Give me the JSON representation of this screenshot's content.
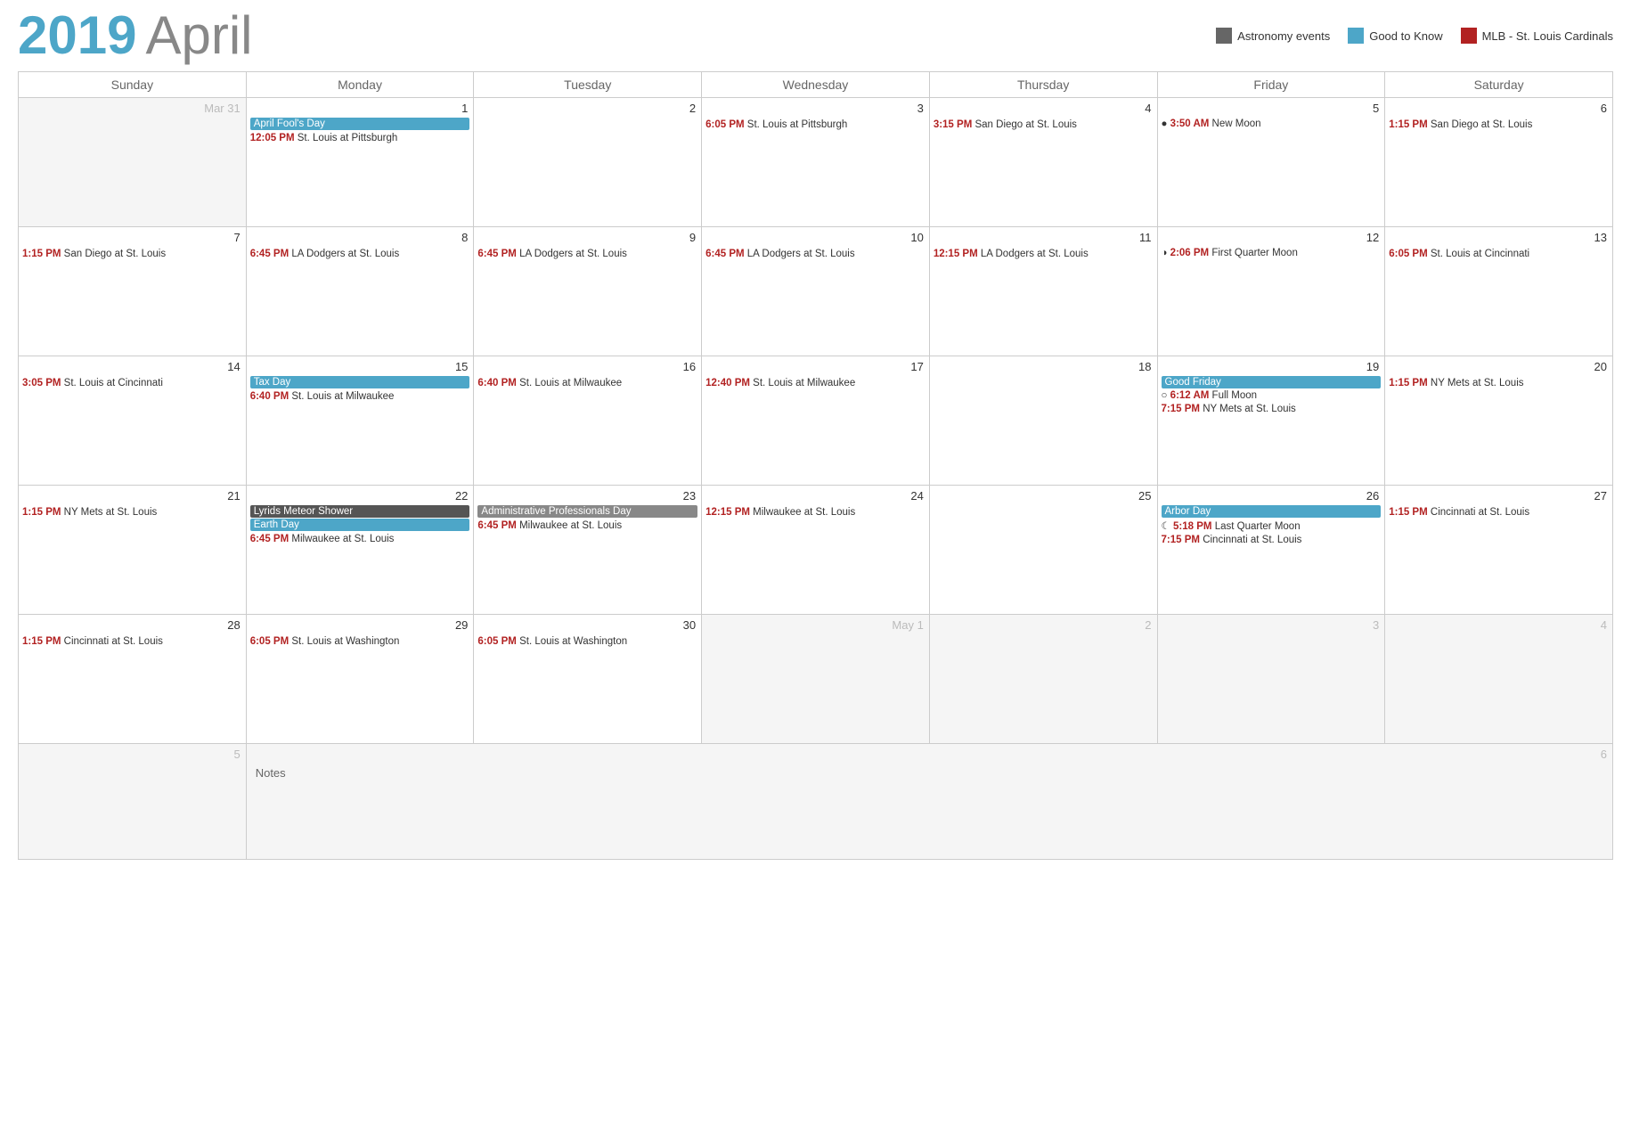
{
  "header": {
    "year": "2019",
    "month": "April"
  },
  "legend": [
    {
      "id": "astronomy",
      "label": "Astronomy events",
      "color_class": "astronomy"
    },
    {
      "id": "goodtoknow",
      "label": "Good to Know",
      "color_class": "goodtoknow"
    },
    {
      "id": "mlb",
      "label": "MLB - St. Louis Cardinals",
      "color_class": "mlb"
    }
  ],
  "days_of_week": [
    "Sunday",
    "Monday",
    "Tuesday",
    "Wednesday",
    "Thursday",
    "Friday",
    "Saturday"
  ],
  "weeks": [
    {
      "days": [
        {
          "num": "Mar 31",
          "gray": true,
          "events": []
        },
        {
          "num": "1",
          "events": [
            {
              "type": "bar-teal",
              "text": "April Fool's Day"
            },
            {
              "type": "mlb",
              "time": "12:05 PM",
              "desc": "St. Louis at Pittsburgh"
            }
          ]
        },
        {
          "num": "2",
          "events": []
        },
        {
          "num": "3",
          "events": [
            {
              "type": "mlb",
              "time": "6:05 PM",
              "desc": "St. Louis at Pittsburgh"
            }
          ]
        },
        {
          "num": "4",
          "events": [
            {
              "type": "mlb",
              "time": "3:15 PM",
              "desc": "San Diego at St. Louis"
            }
          ]
        },
        {
          "num": "5",
          "events": [
            {
              "type": "moon",
              "symbol": "●",
              "time": "3:50 AM",
              "desc": "New Moon"
            }
          ]
        },
        {
          "num": "6",
          "events": [
            {
              "type": "mlb",
              "time": "1:15 PM",
              "desc": "San Diego at St. Louis"
            }
          ]
        }
      ]
    },
    {
      "days": [
        {
          "num": "7",
          "events": [
            {
              "type": "mlb",
              "time": "1:15 PM",
              "desc": "San Diego at St. Louis"
            }
          ]
        },
        {
          "num": "8",
          "events": [
            {
              "type": "mlb",
              "time": "6:45 PM",
              "desc": "LA Dodgers at St. Louis"
            }
          ]
        },
        {
          "num": "9",
          "events": [
            {
              "type": "mlb",
              "time": "6:45 PM",
              "desc": "LA Dodgers at St. Louis"
            }
          ]
        },
        {
          "num": "10",
          "events": [
            {
              "type": "mlb",
              "time": "6:45 PM",
              "desc": "LA Dodgers at St. Louis"
            }
          ]
        },
        {
          "num": "11",
          "events": [
            {
              "type": "mlb",
              "time": "12:15 PM",
              "desc": "LA Dodgers at St. Louis"
            }
          ]
        },
        {
          "num": "12",
          "events": [
            {
              "type": "moon",
              "symbol": "◑",
              "time": "2:06 PM",
              "desc": "First Quarter Moon"
            }
          ]
        },
        {
          "num": "13",
          "events": [
            {
              "type": "mlb",
              "time": "6:05 PM",
              "desc": "St. Louis at Cincinnati"
            }
          ]
        }
      ]
    },
    {
      "days": [
        {
          "num": "14",
          "events": [
            {
              "type": "mlb",
              "time": "3:05 PM",
              "desc": "St. Louis at Cincinnati"
            }
          ]
        },
        {
          "num": "15",
          "events": [
            {
              "type": "bar-teal",
              "text": "Tax Day"
            },
            {
              "type": "mlb",
              "time": "6:40 PM",
              "desc": "St. Louis at Milwaukee"
            }
          ]
        },
        {
          "num": "16",
          "events": [
            {
              "type": "mlb",
              "time": "6:40 PM",
              "desc": "St. Louis at Milwaukee"
            }
          ]
        },
        {
          "num": "17",
          "events": [
            {
              "type": "mlb",
              "time": "12:40 PM",
              "desc": "St. Louis at Milwaukee"
            }
          ]
        },
        {
          "num": "18",
          "events": []
        },
        {
          "num": "19",
          "events": [
            {
              "type": "bar-teal",
              "text": "Good Friday"
            },
            {
              "type": "moon",
              "symbol": "○",
              "time": "6:12 AM",
              "desc": "Full Moon"
            },
            {
              "type": "mlb",
              "time": "7:15 PM",
              "desc": "NY Mets at St. Louis"
            }
          ]
        },
        {
          "num": "20",
          "events": [
            {
              "type": "mlb",
              "time": "1:15 PM",
              "desc": "NY Mets at St. Louis"
            }
          ]
        }
      ]
    },
    {
      "days": [
        {
          "num": "21",
          "events": [
            {
              "type": "mlb",
              "time": "1:15 PM",
              "desc": "NY Mets at St. Louis"
            }
          ]
        },
        {
          "num": "22",
          "events": [
            {
              "type": "bar-dark",
              "text": "Lyrids Meteor Shower"
            },
            {
              "type": "bar-teal",
              "text": "Earth Day"
            },
            {
              "type": "mlb",
              "time": "6:45 PM",
              "desc": "Milwaukee at St. Louis"
            }
          ]
        },
        {
          "num": "23",
          "events": [
            {
              "type": "bar-gray",
              "text": "Administrative Professionals Day"
            },
            {
              "type": "mlb",
              "time": "6:45 PM",
              "desc": "Milwaukee at St. Louis"
            }
          ]
        },
        {
          "num": "24",
          "events": [
            {
              "type": "mlb",
              "time": "12:15 PM",
              "desc": "Milwaukee at St. Louis"
            }
          ]
        },
        {
          "num": "25",
          "events": []
        },
        {
          "num": "26",
          "events": [
            {
              "type": "bar-teal",
              "text": "Arbor Day"
            },
            {
              "type": "moon",
              "symbol": "☾",
              "time": "5:18 PM",
              "desc": "Last Quarter Moon"
            },
            {
              "type": "mlb",
              "time": "7:15 PM",
              "desc": "Cincinnati at St. Louis"
            }
          ]
        },
        {
          "num": "27",
          "events": [
            {
              "type": "mlb",
              "time": "1:15 PM",
              "desc": "Cincinnati at St. Louis"
            }
          ]
        }
      ]
    },
    {
      "days": [
        {
          "num": "28",
          "events": [
            {
              "type": "mlb",
              "time": "1:15 PM",
              "desc": "Cincinnati at St. Louis"
            }
          ]
        },
        {
          "num": "29",
          "events": [
            {
              "type": "mlb",
              "time": "6:05 PM",
              "desc": "St. Louis at Washington"
            }
          ]
        },
        {
          "num": "30",
          "events": [
            {
              "type": "mlb",
              "time": "6:05 PM",
              "desc": "St. Louis at Washington"
            }
          ]
        },
        {
          "num": "May 1",
          "gray": true,
          "events": []
        },
        {
          "num": "2",
          "gray": true,
          "events": []
        },
        {
          "num": "3",
          "gray": true,
          "events": []
        },
        {
          "num": "4",
          "gray": true,
          "events": []
        }
      ]
    },
    {
      "notes_row": true,
      "days": [
        {
          "num": "5",
          "gray": true,
          "events": []
        },
        {
          "num": "6",
          "gray": true,
          "events": [],
          "notes": true
        }
      ]
    }
  ]
}
